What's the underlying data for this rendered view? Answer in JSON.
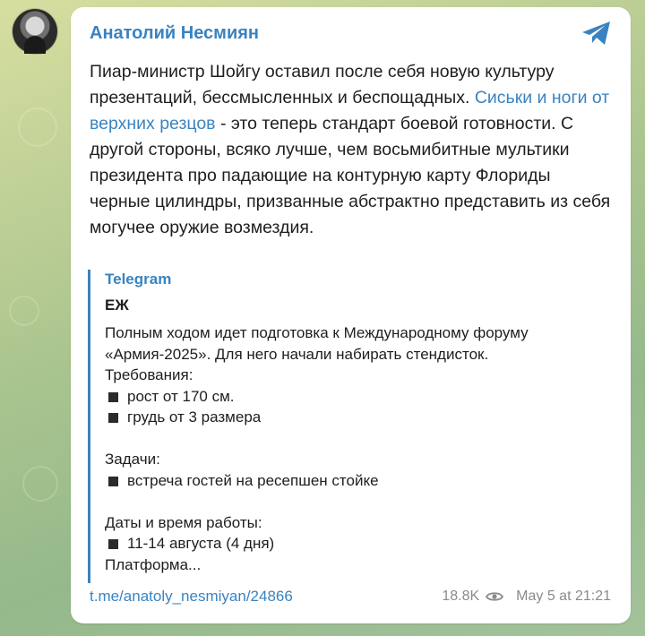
{
  "post": {
    "author": "Анатолий Несмиян",
    "text_part1": "Пиар-министр Шойгу оставил после себя новую культуру презентаций, бессмысленных и беспощадных. ",
    "link_text": "Сиськи и ноги от верхних резцов",
    "text_part2": " - это теперь стандарт боевой готовности. С другой стороны, всяко лучше, чем восьмибитные мультики президента про падающие на контурную карту Флориды черные цилиндры, призванные абстрактно представить из себя могучее оружие возмездия."
  },
  "quote": {
    "source": "Telegram",
    "title": "ЕЖ",
    "lines": [
      "Полным ходом идет подготовка к Международному форуму",
      "«Армия-2025». Для него начали набирать стендисток.",
      "Требования:"
    ],
    "req1": "рост от 170 см.",
    "req2": "грудь от 3 размера",
    "tasks_label": "Задачи:",
    "task1": "встреча гостей на ресепшен стойке",
    "dates_label": "Даты и время работы:",
    "date1": "11-14 августа (4 дня)",
    "platform": "Платформа..."
  },
  "footer": {
    "link": "t.me/anatoly_nesmiyan/24866",
    "views": "18.8K",
    "timestamp": "May 5 at 21:21"
  },
  "icons": {
    "share": "telegram-share-icon",
    "views": "eye-icon",
    "bullet": "black-square-icon"
  },
  "colors": {
    "accent": "#3a83c0",
    "text": "#1e1e1e",
    "muted": "#8a8a8a"
  }
}
